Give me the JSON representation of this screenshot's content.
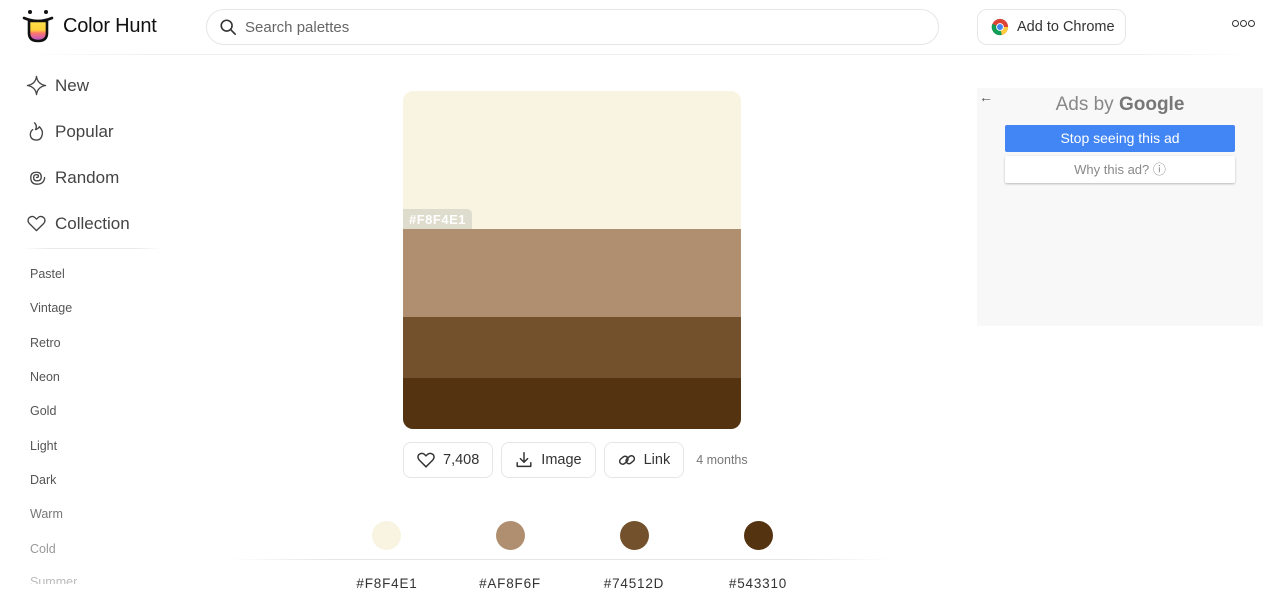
{
  "header": {
    "app_name": "Color Hunt",
    "search_placeholder": "Search palettes",
    "search_value": "",
    "chrome_button_label": "Add to Chrome"
  },
  "sidebar": {
    "nav": [
      {
        "label": "New",
        "icon": "sparkle-icon"
      },
      {
        "label": "Popular",
        "icon": "flame-icon"
      },
      {
        "label": "Random",
        "icon": "spiral-icon"
      },
      {
        "label": "Collection",
        "icon": "heart-icon"
      }
    ],
    "tags": [
      "Pastel",
      "Vintage",
      "Retro",
      "Neon",
      "Gold",
      "Light",
      "Dark",
      "Warm",
      "Cold",
      "Summer"
    ]
  },
  "palette": {
    "colors": [
      {
        "hex": "#F8F4E1",
        "label": "#F8F4E1"
      },
      {
        "hex": "#AF8F6F",
        "label": "#AF8F6F"
      },
      {
        "hex": "#74512D",
        "label": "#74512D"
      },
      {
        "hex": "#543310",
        "label": "#543310"
      }
    ],
    "hover_label": "#F8F4E1",
    "likes": "7,408",
    "image_label": "Image",
    "link_label": "Link",
    "age": "4 months"
  },
  "ad": {
    "title_prefix": "Ads by",
    "title_brand": "Google",
    "stop_label": "Stop seeing this ad",
    "why_label": "Why this ad? ⓘ",
    "back_icon": "←"
  },
  "colors": {
    "ad_blue": "#4285f4"
  }
}
